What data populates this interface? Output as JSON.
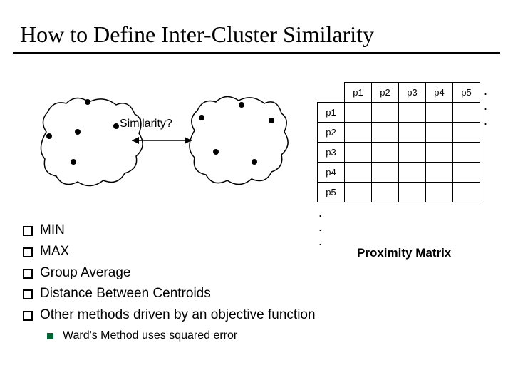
{
  "title": "How to Define Inter-Cluster Similarity",
  "diagram": {
    "similarity_label": "Similarity?",
    "cluster_a_points": 5,
    "cluster_b_points": 5
  },
  "matrix": {
    "cols": [
      "p1",
      "p2",
      "p3",
      "p4",
      "p5"
    ],
    "rows": [
      "p1",
      "p2",
      "p3",
      "p4",
      "p5"
    ],
    "col_ellipsis": ". . .",
    "row_ellipsis": [
      ".",
      ".",
      "."
    ],
    "caption": "Proximity Matrix"
  },
  "bullets": {
    "items": [
      "MIN",
      "MAX",
      "Group Average",
      "Distance Between Centroids",
      "Other methods driven by an objective function"
    ],
    "sub": "Ward's Method uses squared error"
  }
}
